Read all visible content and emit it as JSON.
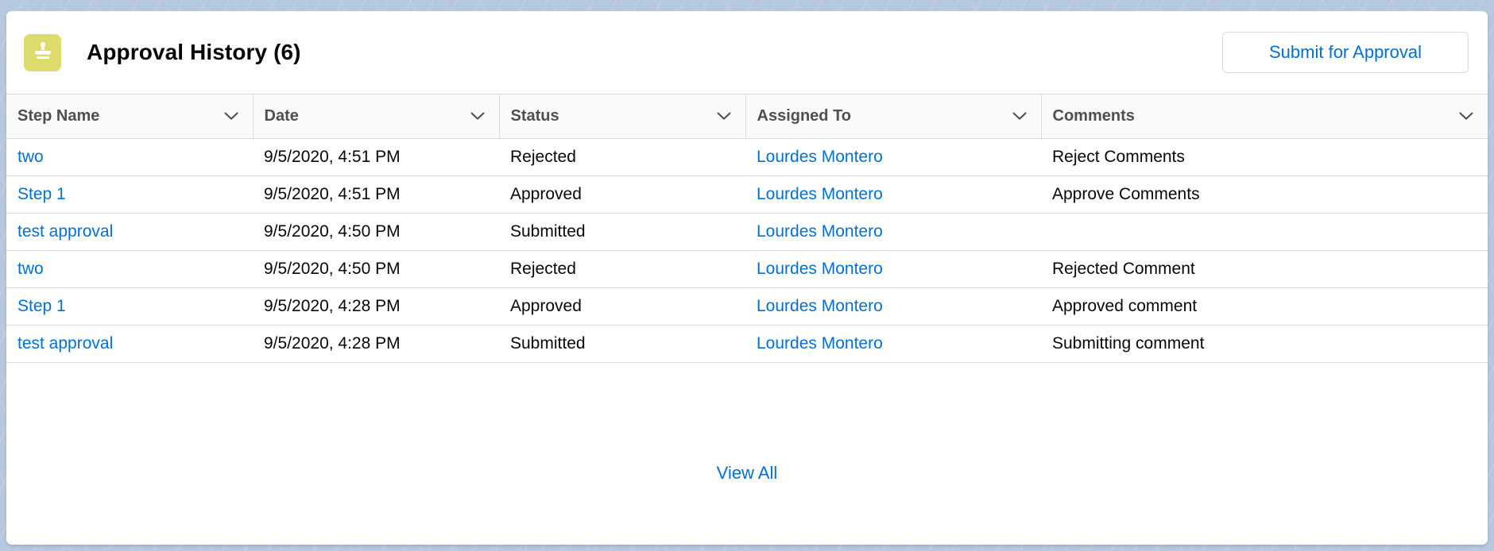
{
  "colors": {
    "page_background": "#b6c8de",
    "card_background": "#ffffff",
    "accent_link": "#0070d2",
    "icon_tile": "#dbdb6e",
    "header_row_background": "#fafaf9",
    "border": "#dddbda",
    "text_primary": "#080707",
    "text_header": "#514f4d"
  },
  "header": {
    "icon_name": "approval-stamp-icon",
    "title": "Approval History (6)",
    "submit_button_label": "Submit for Approval"
  },
  "table": {
    "columns": [
      {
        "label": "Step Name",
        "sort_icon": "chevron-down-icon"
      },
      {
        "label": "Date",
        "sort_icon": "chevron-down-icon"
      },
      {
        "label": "Status",
        "sort_icon": "chevron-down-icon"
      },
      {
        "label": "Assigned To",
        "sort_icon": "chevron-down-icon"
      },
      {
        "label": "Comments",
        "sort_icon": "chevron-down-icon"
      }
    ],
    "rows": [
      {
        "step_name": "two",
        "date": "9/5/2020, 4:51 PM",
        "status": "Rejected",
        "assigned_to": "Lourdes Montero",
        "comments": "Reject Comments"
      },
      {
        "step_name": "Step 1",
        "date": "9/5/2020, 4:51 PM",
        "status": "Approved",
        "assigned_to": "Lourdes Montero",
        "comments": "Approve Comments"
      },
      {
        "step_name": "test approval",
        "date": "9/5/2020, 4:50 PM",
        "status": "Submitted",
        "assigned_to": "Lourdes Montero",
        "comments": ""
      },
      {
        "step_name": "two",
        "date": "9/5/2020, 4:50 PM",
        "status": "Rejected",
        "assigned_to": "Lourdes Montero",
        "comments": "Rejected Comment"
      },
      {
        "step_name": "Step 1",
        "date": "9/5/2020, 4:28 PM",
        "status": "Approved",
        "assigned_to": "Lourdes Montero",
        "comments": "Approved comment"
      },
      {
        "step_name": "test approval",
        "date": "9/5/2020, 4:28 PM",
        "status": "Submitted",
        "assigned_to": "Lourdes Montero",
        "comments": "Submitting comment"
      }
    ]
  },
  "footer": {
    "view_all_label": "View All"
  }
}
